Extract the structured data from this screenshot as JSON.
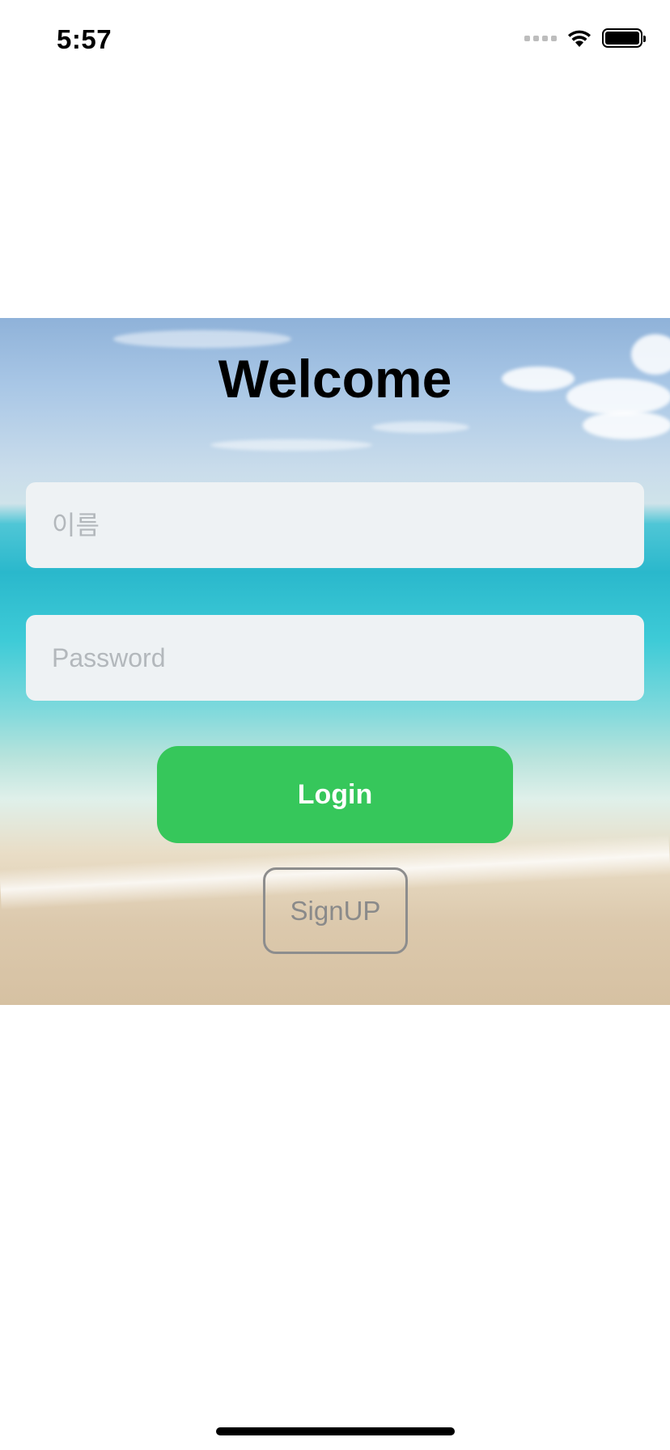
{
  "status_bar": {
    "time": "5:57"
  },
  "login_screen": {
    "title": "Welcome",
    "name_placeholder": "이름",
    "password_placeholder": "Password",
    "login_label": "Login",
    "signup_label": "SignUP"
  },
  "colors": {
    "login_button": "#36c75b",
    "input_background": "#eef2f4",
    "signup_border": "#8d8d8d"
  }
}
